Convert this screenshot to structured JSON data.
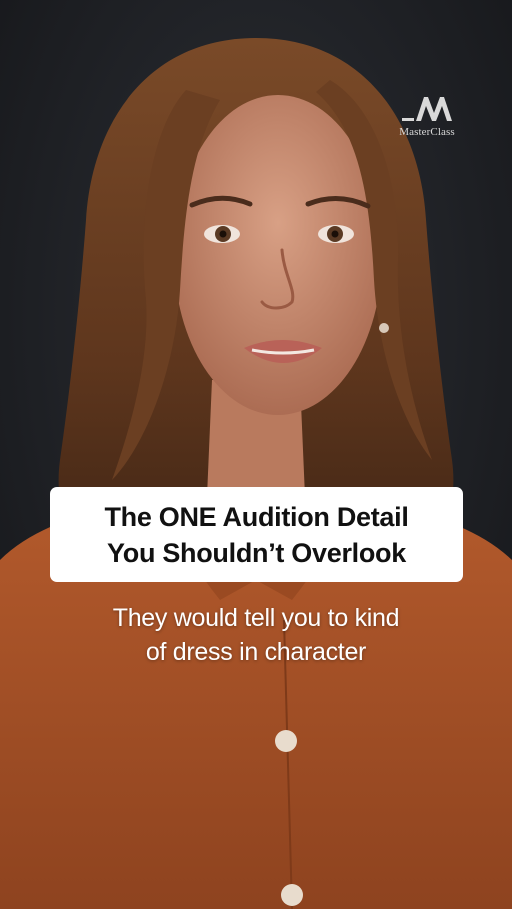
{
  "brand": {
    "logo_icon": "masterclass-m-icon",
    "name": "MasterClass"
  },
  "title_card": {
    "line1": "The ONE Audition Detail",
    "line2": "You Shouldn’t Overlook"
  },
  "caption": {
    "line1": "They would tell you to kind",
    "line2": "of dress in character"
  },
  "colors": {
    "backdrop": "#1c1e22",
    "shirt": "#a24e25",
    "hair": "#6b3f22",
    "skin": "#c88c70",
    "card": "#ffffff",
    "card_text": "#111111",
    "caption_text": "#ffffff"
  }
}
